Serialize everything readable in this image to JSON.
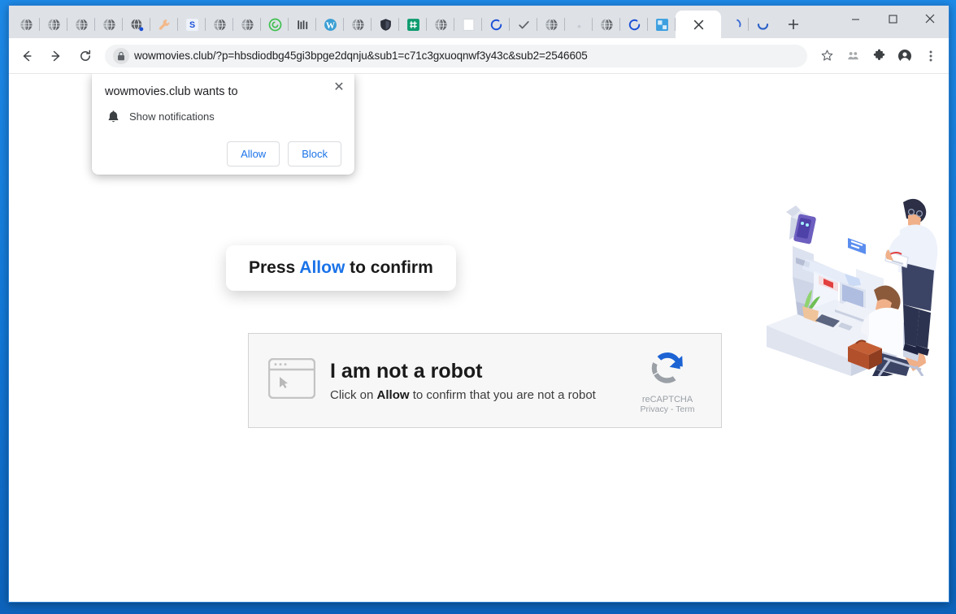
{
  "window": {
    "controls": [
      {
        "name": "minimize-button",
        "glyph": "–"
      },
      {
        "name": "maximize-button",
        "glyph": "❐"
      },
      {
        "name": "close-button",
        "glyph": "✕"
      }
    ]
  },
  "tabstrip": {
    "tabs": [
      {
        "icon": "globe-icon",
        "active": false
      },
      {
        "icon": "globe-icon",
        "active": false
      },
      {
        "icon": "globe-icon",
        "active": false
      },
      {
        "icon": "globe-icon",
        "active": false
      },
      {
        "icon": "globe-badge-icon",
        "active": false
      },
      {
        "icon": "wrench-icon",
        "active": false
      },
      {
        "icon": "letter-s-icon",
        "active": false
      },
      {
        "icon": "globe-icon",
        "active": false
      },
      {
        "icon": "globe-icon",
        "active": false
      },
      {
        "icon": "green-spiral-icon",
        "active": false
      },
      {
        "icon": "bars-icon",
        "active": false
      },
      {
        "icon": "wordpress-icon",
        "active": false
      },
      {
        "icon": "globe-icon",
        "active": false
      },
      {
        "icon": "shield-icon",
        "active": false
      },
      {
        "icon": "green-hash-icon",
        "active": false
      },
      {
        "icon": "globe-icon",
        "active": false
      },
      {
        "icon": "blank-page-icon",
        "active": false
      },
      {
        "icon": "loading-spinner-icon",
        "active": false
      },
      {
        "icon": "checkmark-icon",
        "active": false
      },
      {
        "icon": "globe-icon",
        "active": false
      },
      {
        "icon": "faint-dot-icon",
        "active": false
      },
      {
        "icon": "globe-icon",
        "active": false
      },
      {
        "icon": "loading-spinner-icon",
        "active": false
      },
      {
        "icon": "blue-folder-icon",
        "active": false
      },
      {
        "icon": "close-icon",
        "active": true
      },
      {
        "icon": "partial-spinner-icon",
        "active": false
      },
      {
        "icon": "blue-arc-icon",
        "active": false
      }
    ],
    "new_tab_label": "+"
  },
  "toolbar": {
    "back_label": "←",
    "forward_label": "→",
    "reload_label": "⟳",
    "url": "wowmovies.club/?p=hbsdiodbg45gi3bpge2dqnju&sub1=c71c3gxuoqnwf3y43c&sub2=2546605",
    "lock_icon": "lock-icon",
    "actions": [
      {
        "name": "bookmark-star-icon",
        "glyph": "☆"
      },
      {
        "name": "share-people-icon",
        "glyph": "⚘"
      },
      {
        "name": "extensions-puzzle-icon",
        "glyph": "❖"
      },
      {
        "name": "profile-avatar-icon",
        "glyph": "●"
      },
      {
        "name": "chrome-menu-icon",
        "glyph": "⋮"
      }
    ]
  },
  "permission_dialog": {
    "title": "wowmovies.club wants to",
    "permission_label": "Show notifications",
    "permission_icon": "bell-icon",
    "allow_label": "Allow",
    "block_label": "Block",
    "close_label": "✕"
  },
  "speech_bubble": {
    "prefix": "Press ",
    "highlight": "Allow",
    "suffix": " to confirm"
  },
  "captcha": {
    "window_icon": "browser-window-cursor-icon",
    "heading": "I am not a robot",
    "subtext_before": "Click on ",
    "subtext_bold": "Allow",
    "subtext_after": " to confirm that you are not a robot",
    "brand": "reCAPTCHA",
    "legal": "Privacy - Term"
  },
  "illustration": {
    "name": "robot-and-office-workers-illustration"
  },
  "colors": {
    "accent_blue": "#1a73e8",
    "window_frame": "#1277d6",
    "tabstrip_bg": "#dee1e6",
    "omnibox_bg": "#f1f3f4",
    "captcha_bg": "#f7f7f7",
    "recaptcha_blue": "#1c63d4",
    "recaptcha_gray": "#9aa0a6"
  }
}
